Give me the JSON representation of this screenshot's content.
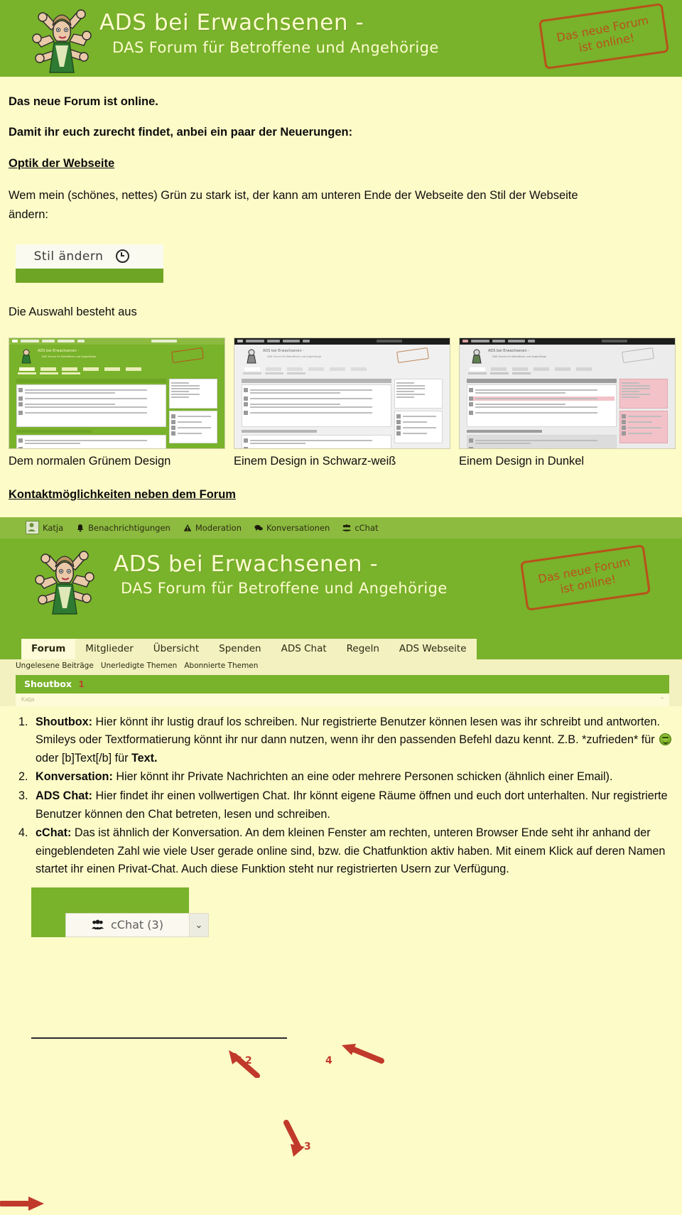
{
  "colors": {
    "green": "#79b22b",
    "nav_green": "#8cbb3f",
    "page_bg": "#fdfbc8",
    "stamp": "#b9511a",
    "marker_red": "#c0392b",
    "banner_text": "#fdfbd0"
  },
  "banner": {
    "title": "ADS bei Erwachsenen -",
    "subtitle": "DAS Forum für Betroffene und Angehörige",
    "stamp_line1": "Das neue Forum",
    "stamp_line2": "ist online!",
    "mascot_alt": "mascot-illustration"
  },
  "intro": {
    "line1": "Das neue Forum ist online.",
    "line2": "Damit ihr euch zurecht findet, anbei ein paar der Neuerungen:",
    "heading1": "Optik der Webseite",
    "para1": "Wem mein (schönes, nettes) Grün zu stark ist, der kann am unteren Ende der Webseite den Stil der Webseite",
    "para1b": "ändern:"
  },
  "style_widget": {
    "label": "Stil ändern",
    "icon": "clock-icon"
  },
  "selection": {
    "lead": "Die Auswahl besteht aus",
    "thumbs": [
      {
        "caption": "Dem normalen Grünem Design",
        "theme": "green"
      },
      {
        "caption": "Einem Design in Schwarz-weiß",
        "theme": "bw"
      },
      {
        "caption": "Einem Design in Dunkel",
        "theme": "dark"
      }
    ]
  },
  "contact": {
    "heading": "Kontaktmöglichkeiten neben dem Forum"
  },
  "forum_screenshot": {
    "topnav": [
      {
        "label": "Katja",
        "icon": "avatar-icon"
      },
      {
        "label": "Benachrichtigungen",
        "icon": "bell-icon"
      },
      {
        "label": "Moderation",
        "icon": "warning-triangle-icon"
      },
      {
        "label": "Konversationen",
        "icon": "speech-bubbles-icon"
      },
      {
        "label": "cChat",
        "icon": "users-group-icon"
      }
    ],
    "tabs": [
      {
        "label": "Forum",
        "active": true
      },
      {
        "label": "Mitglieder",
        "active": false
      },
      {
        "label": "Übersicht",
        "active": false
      },
      {
        "label": "Spenden",
        "active": false
      },
      {
        "label": "ADS Chat",
        "active": false
      },
      {
        "label": "Regeln",
        "active": false
      },
      {
        "label": "ADS Webseite",
        "active": false
      }
    ],
    "subnav": [
      "Ungelesene Beiträge",
      "Unerledigte Themen",
      "Abonnierte Themen"
    ],
    "shoutbox_label": "Shoutbox",
    "shoutbox_user": "Katja",
    "markers": {
      "m1": "1",
      "m2": "2",
      "m3": "3",
      "m4": "4"
    }
  },
  "notes": [
    {
      "num": "1.",
      "term": "Shoutbox:",
      "text_a": "Hier könnt ihr lustig drauf los schreiben. Nur registrierte Benutzer können lesen was ihr schreibt und antworten. Smileys oder Textformatierung könnt ihr nur dann nutzen, wenn ihr den passenden Befehl dazu kennt. Z.B. *zufrieden* für",
      "text_b": "oder [b]Text[/b] für",
      "text_bold_tail": "Text.",
      "has_smiley": true
    },
    {
      "num": "2.",
      "term": "Konversation:",
      "text_a": "Hier könnt ihr Private Nachrichten an eine oder mehrere Personen schicken (ähnlich einer Email).",
      "has_smiley": false
    },
    {
      "num": "3.",
      "term": "ADS Chat:",
      "text_a": "Hier findet ihr einen vollwertigen Chat. Ihr könnt eigene Räume öffnen und euch dort unterhalten. Nur registrierte Benutzer können den Chat betreten, lesen und schreiben.",
      "has_smiley": false
    },
    {
      "num": "4.",
      "term": "cChat:",
      "text_a": "Das ist ähnlich der Konversation. An dem kleinen Fenster am rechten, unteren Browser Ende seht ihr anhand der eingeblendeten Zahl wie viele User gerade online sind, bzw. die Chatfunktion aktiv haben. Mit einem Klick auf deren Namen startet ihr einen Privat-Chat. Auch diese Funktion steht nur registrierten Usern zur Verfügung.",
      "has_smiley": false
    }
  ],
  "cchat_widget": {
    "label": "cChat (3)",
    "icon": "users-group-icon",
    "caret": "⌄"
  }
}
